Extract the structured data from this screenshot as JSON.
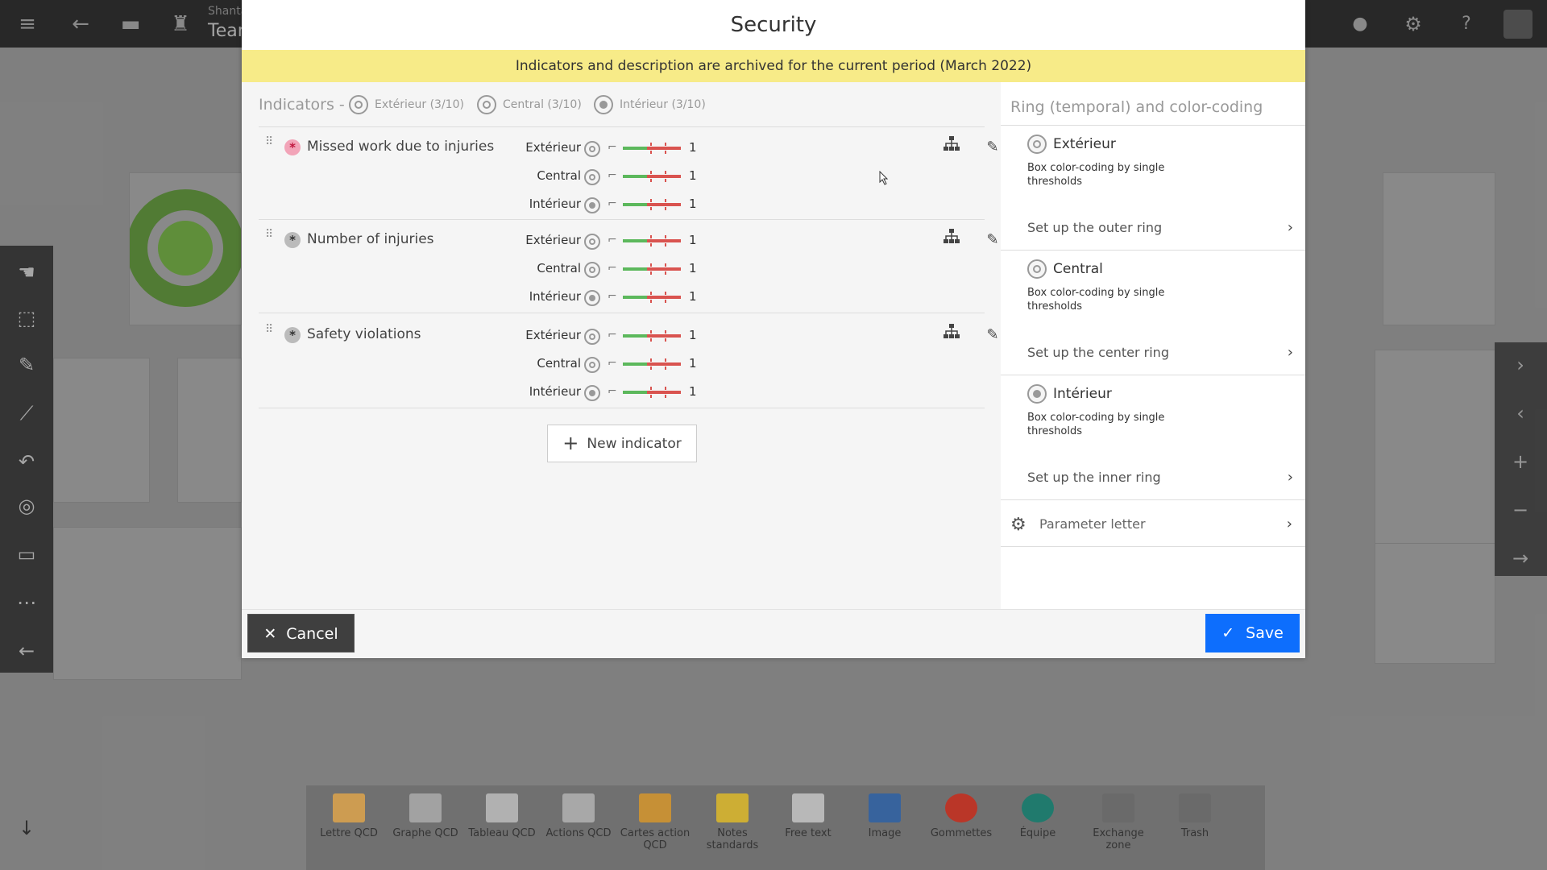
{
  "topbar": {
    "user_name": "Shanta",
    "team": "Team"
  },
  "modal": {
    "title": "Security",
    "banner": "Indicators and description are archived for the current period (March 2022)",
    "indicators_header": {
      "label": "Indicators -",
      "legend": [
        {
          "name": "Extérieur (3/10)"
        },
        {
          "name": "Central (3/10)"
        },
        {
          "name": "Intérieur (3/10)"
        }
      ]
    },
    "indicators": [
      {
        "name": "Missed work due to injuries",
        "icon_color": "#f2a4b8",
        "rows": [
          {
            "label": "Extérieur",
            "value": "1"
          },
          {
            "label": "Central",
            "value": "1"
          },
          {
            "label": "Intérieur",
            "value": "1"
          }
        ]
      },
      {
        "name": "Number of injuries",
        "icon_color": "#bbbbbb",
        "rows": [
          {
            "label": "Extérieur",
            "value": "1"
          },
          {
            "label": "Central",
            "value": "1"
          },
          {
            "label": "Intérieur",
            "value": "1"
          }
        ]
      },
      {
        "name": "Safety violations",
        "icon_color": "#bbbbbb",
        "rows": [
          {
            "label": "Extérieur",
            "value": "1"
          },
          {
            "label": "Central",
            "value": "1"
          },
          {
            "label": "Intérieur",
            "value": "1"
          }
        ]
      }
    ],
    "new_indicator_label": "New indicator",
    "right_panel": {
      "title": "Ring (temporal) and color-coding",
      "rings": [
        {
          "name": "Extérieur",
          "desc": "Box color-coding by single thresholds",
          "link": "Set up the outer ring"
        },
        {
          "name": "Central",
          "desc": "Box color-coding by single thresholds",
          "link": "Set up the center ring"
        },
        {
          "name": "Intérieur",
          "desc": "Box color-coding by single thresholds",
          "link": "Set up the inner ring"
        }
      ],
      "parameter_letter": "Parameter letter"
    },
    "cancel_label": "Cancel",
    "save_label": "Save",
    "colors": {
      "banner": "#f7eb88",
      "save": "#0d6efd",
      "cancel": "#3f3f3f",
      "threshold_green": "#5cb85c",
      "threshold_red": "#d9534f"
    }
  },
  "dock": {
    "items": [
      {
        "label": "Lettre QCD",
        "icon": "letter-icon"
      },
      {
        "label": "Graphe QCD",
        "icon": "graph-icon"
      },
      {
        "label": "Tableau QCD",
        "icon": "table-icon"
      },
      {
        "label": "Actions QCD",
        "icon": "actions-icon"
      },
      {
        "label": "Cartes action QCD",
        "icon": "cards-icon"
      },
      {
        "label": "Notes standards",
        "icon": "note-icon"
      },
      {
        "label": "Free text",
        "icon": "text-icon"
      },
      {
        "label": "Image",
        "icon": "image-icon"
      },
      {
        "label": "Gommettes",
        "icon": "sticker-icon"
      },
      {
        "label": "Équipe",
        "icon": "team-icon"
      },
      {
        "label": "Exchange zone",
        "icon": "exchange-icon"
      },
      {
        "label": "Trash",
        "icon": "trash-icon"
      }
    ]
  }
}
